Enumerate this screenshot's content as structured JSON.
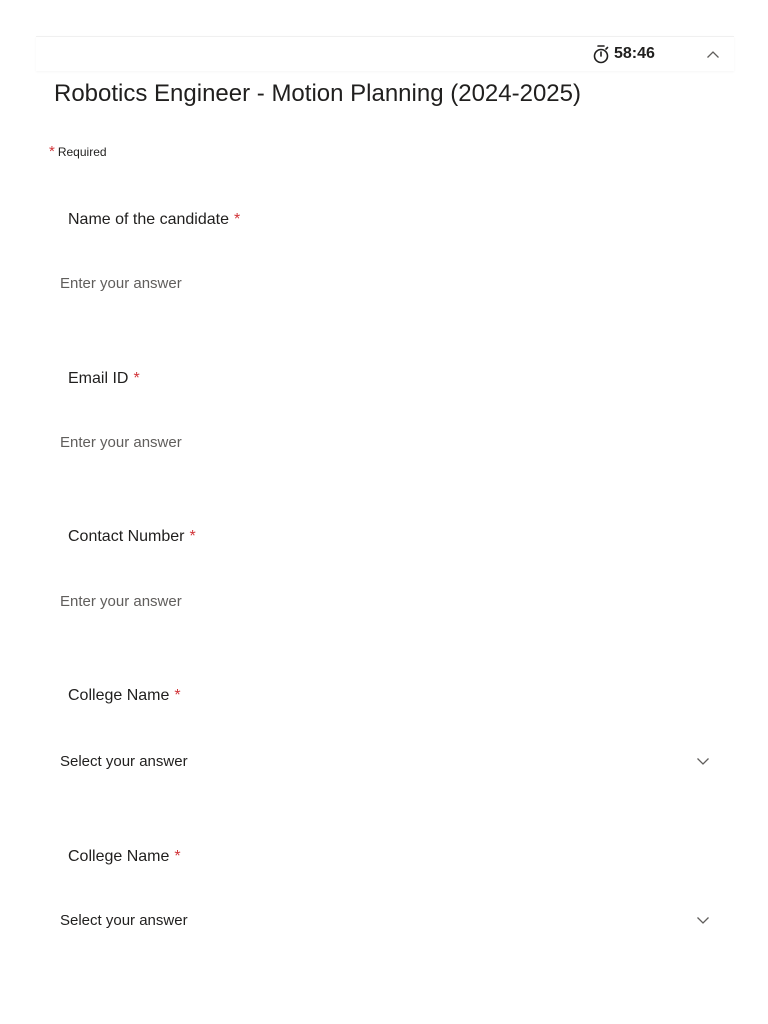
{
  "header": {
    "timer": "58:46",
    "timer_icon": "stopwatch-icon",
    "collapse_icon": "chevron-up-icon"
  },
  "form": {
    "title": "Robotics Engineer - Motion Planning (2024-2025)",
    "required_marker": "*",
    "required_note": "Required",
    "questions": [
      {
        "label": "Name of the candidate",
        "required": "*",
        "type": "text",
        "placeholder": "Enter your answer"
      },
      {
        "label": "Email ID",
        "required": "*",
        "type": "text",
        "placeholder": "Enter your answer"
      },
      {
        "label": "Contact Number",
        "required": "*",
        "type": "text",
        "placeholder": "Enter your answer"
      },
      {
        "label": "College Name",
        "required": "*",
        "type": "select",
        "selected": "Select your answer"
      },
      {
        "label": "College Name",
        "required": "*",
        "type": "select",
        "selected": "Select your answer"
      }
    ]
  },
  "colors": {
    "required_star": "#d13438",
    "text": "#201f1e",
    "placeholder": "#605e5c"
  }
}
